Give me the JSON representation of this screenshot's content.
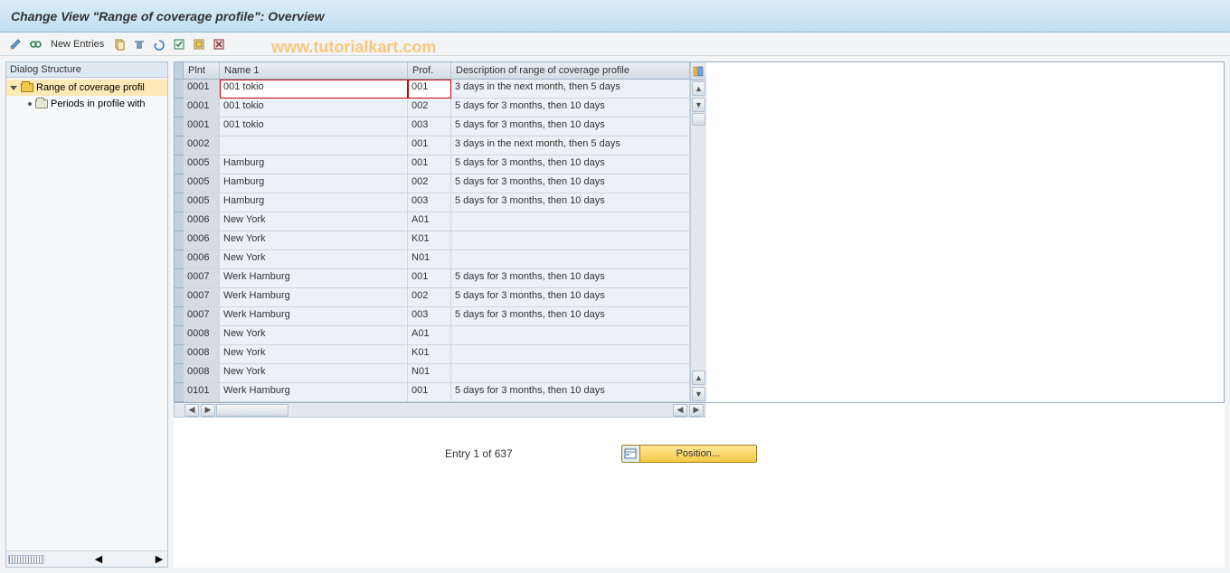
{
  "title": "Change View \"Range of coverage profile\": Overview",
  "toolbar": {
    "new_entries": "New Entries"
  },
  "watermark": "www.tutorialkart.com",
  "sidebar": {
    "header": "Dialog Structure",
    "root": "Range of coverage profil",
    "child": "Periods in profile with"
  },
  "table": {
    "columns": {
      "plnt": "Plnt",
      "name": "Name 1",
      "prof": "Prof.",
      "desc": "Description of range of coverage profile"
    },
    "rows": [
      {
        "plnt": "0001",
        "name": "001 tokio",
        "prof": "001",
        "desc": "3 days in the next month, then 5 days"
      },
      {
        "plnt": "0001",
        "name": "001 tokio",
        "prof": "002",
        "desc": "5 days for 3 months, then 10 days"
      },
      {
        "plnt": "0001",
        "name": "001 tokio",
        "prof": "003",
        "desc": "5 days for 3 months, then 10 days"
      },
      {
        "plnt": "0002",
        "name": "",
        "prof": "001",
        "desc": "3 days in the next month, then 5 days"
      },
      {
        "plnt": "0005",
        "name": "Hamburg",
        "prof": "001",
        "desc": "5 days for 3 months, then 10 days"
      },
      {
        "plnt": "0005",
        "name": "Hamburg",
        "prof": "002",
        "desc": "5 days for 3 months, then 10 days"
      },
      {
        "plnt": "0005",
        "name": "Hamburg",
        "prof": "003",
        "desc": "5 days for 3 months, then 10 days"
      },
      {
        "plnt": "0006",
        "name": "New York",
        "prof": "A01",
        "desc": ""
      },
      {
        "plnt": "0006",
        "name": "New York",
        "prof": "K01",
        "desc": ""
      },
      {
        "plnt": "0006",
        "name": "New York",
        "prof": "N01",
        "desc": ""
      },
      {
        "plnt": "0007",
        "name": "Werk Hamburg",
        "prof": "001",
        "desc": "5 days for 3 months, then 10 days"
      },
      {
        "plnt": "0007",
        "name": "Werk Hamburg",
        "prof": "002",
        "desc": "5 days for 3 months, then 10 days"
      },
      {
        "plnt": "0007",
        "name": "Werk Hamburg",
        "prof": "003",
        "desc": "5 days for 3 months, then 10 days"
      },
      {
        "plnt": "0008",
        "name": "New York",
        "prof": "A01",
        "desc": ""
      },
      {
        "plnt": "0008",
        "name": "New York",
        "prof": "K01",
        "desc": ""
      },
      {
        "plnt": "0008",
        "name": "New York",
        "prof": "N01",
        "desc": ""
      },
      {
        "plnt": "0101",
        "name": "Werk Hamburg",
        "prof": "001",
        "desc": "5 days for 3 months, then 10 days"
      }
    ]
  },
  "footer": {
    "entry_text": "Entry 1 of 637",
    "position_btn": "Position..."
  },
  "icons": {
    "glasses": "glasses-icon",
    "pencil": "pencil-icon",
    "copy": "copy-icon",
    "select_all": "select-all-icon",
    "undo": "undo-icon",
    "deselect": "deselect-icon",
    "block_select": "block-select-icon",
    "block_deselect": "block-deselect-icon"
  }
}
